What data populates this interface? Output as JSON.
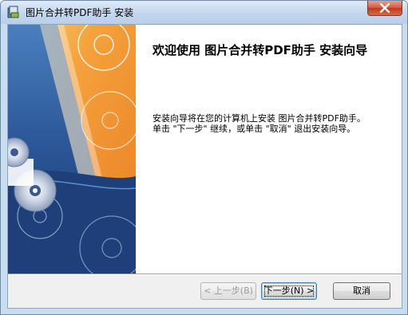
{
  "window": {
    "title": "图片合并转PDF助手 安装",
    "app_icon": "installer-icon",
    "close_icon": "close-icon"
  },
  "welcome": {
    "heading": "欢迎使用 图片合并转PDF助手 安装向导",
    "line1": "安装向导将在您的计算机上安装 图片合并转PDF助手。",
    "line2": "单击 \"下一步\" 继续，或单击 \"取消\" 退出安装向导。"
  },
  "buttons": {
    "back": "< 上一步(B)",
    "next": "下一步(N) >",
    "cancel": "取消"
  },
  "colors": {
    "banner_blue": "#1f3f7a",
    "banner_orange": "#f4a23c",
    "close_red": "#c9452a"
  }
}
